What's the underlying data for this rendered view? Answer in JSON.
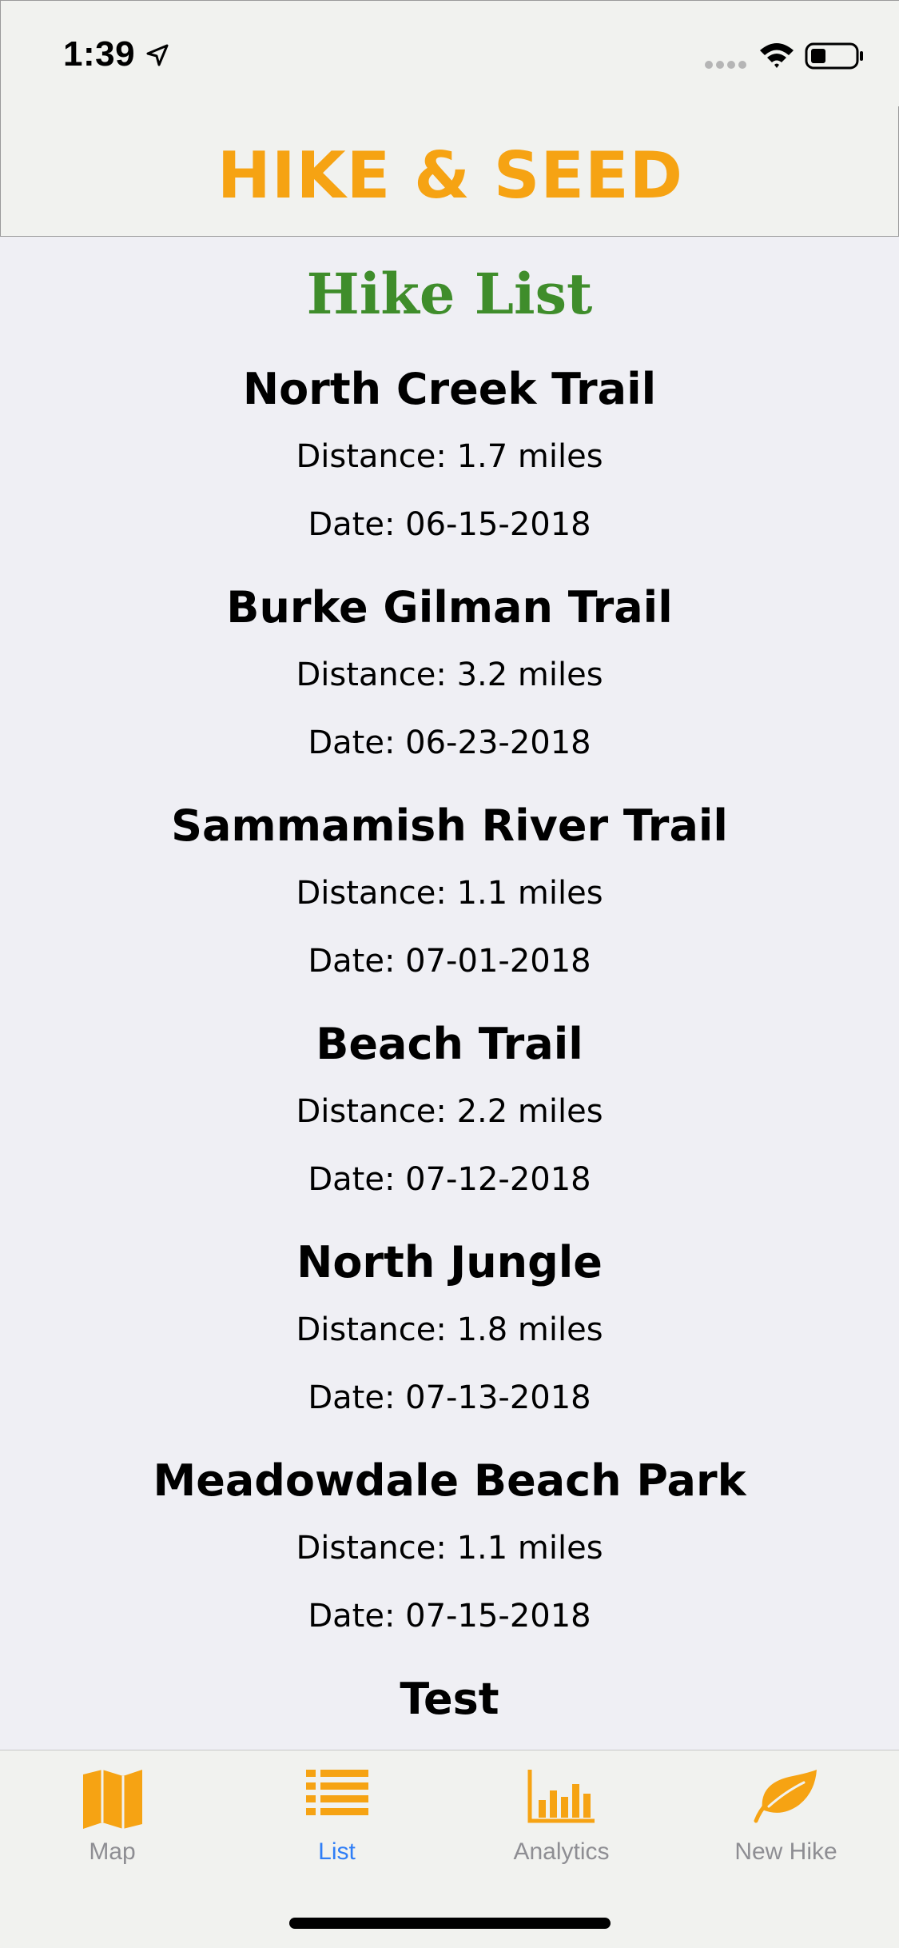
{
  "status_bar": {
    "time": "1:39"
  },
  "header": {
    "app_title": "HIKE & SEED"
  },
  "main": {
    "heading": "Hike List",
    "hikes": [
      {
        "name": "North Creek Trail",
        "distance": "Distance: 1.7 miles",
        "date": "Date: 06-15-2018"
      },
      {
        "name": "Burke Gilman Trail",
        "distance": "Distance: 3.2 miles",
        "date": "Date: 06-23-2018"
      },
      {
        "name": "Sammamish River Trail",
        "distance": "Distance: 1.1 miles",
        "date": "Date: 07-01-2018"
      },
      {
        "name": "Beach Trail",
        "distance": "Distance: 2.2 miles",
        "date": "Date: 07-12-2018"
      },
      {
        "name": "North Jungle",
        "distance": "Distance: 1.8 miles",
        "date": "Date: 07-13-2018"
      },
      {
        "name": "Meadowdale Beach Park",
        "distance": "Distance: 1.1 miles",
        "date": "Date: 07-15-2018"
      },
      {
        "name": "Test",
        "distance": "",
        "date": ""
      }
    ]
  },
  "tab_bar": {
    "tabs": [
      {
        "label": "Map",
        "icon": "map-icon",
        "active": false
      },
      {
        "label": "List",
        "icon": "list-icon",
        "active": true
      },
      {
        "label": "Analytics",
        "icon": "bar-chart-icon",
        "active": false
      },
      {
        "label": "New Hike",
        "icon": "leaf-icon",
        "active": false
      }
    ]
  },
  "colors": {
    "brand_orange": "#f6a313",
    "heading_green": "#3f8d2b",
    "active_tab_blue": "#2f7ef6",
    "inactive_tab_gray": "#8e8e93"
  }
}
